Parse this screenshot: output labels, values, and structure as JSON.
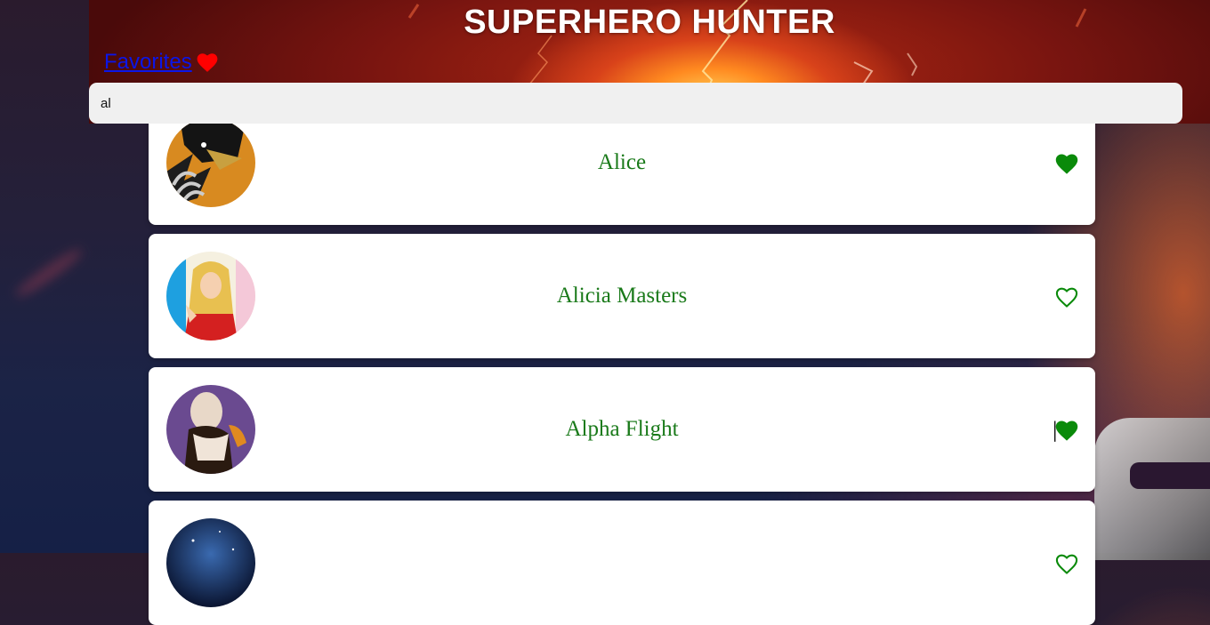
{
  "header": {
    "title": "SUPERHERO HUNTER",
    "favorites_label": "Favorites",
    "favorites_icon": "heart-icon",
    "favorites_icon_color": "#ff0000"
  },
  "search": {
    "value": "al",
    "placeholder": ""
  },
  "colors": {
    "name_color": "#1a7a1a",
    "heart_color": "#0a8a0a"
  },
  "results": [
    {
      "name": "Alice",
      "favorited": true
    },
    {
      "name": "Alicia Masters",
      "favorited": false
    },
    {
      "name": "Alpha Flight",
      "favorited": true
    },
    {
      "name": "",
      "favorited": false
    }
  ]
}
